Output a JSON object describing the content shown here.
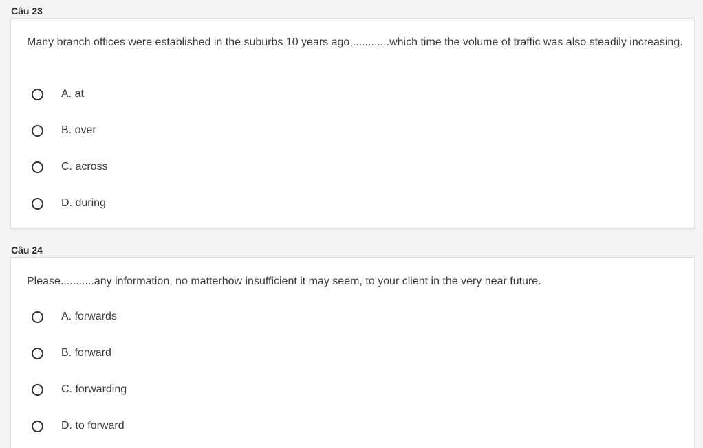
{
  "questions": [
    {
      "label": "Câu 23",
      "text": "Many branch offices were established in the suburbs 10 years ago,............which time the volume of traffic was also steadily increasing.",
      "options": [
        "A. at",
        "B. over",
        "C. across",
        "D. during"
      ]
    },
    {
      "label": "Câu 24",
      "text": "Please...........any information, no matterhow insufficient it may seem, to your client in the very near future.",
      "options": [
        "A. forwards",
        "B. forward",
        "C. forwarding",
        "D. to forward"
      ]
    }
  ]
}
